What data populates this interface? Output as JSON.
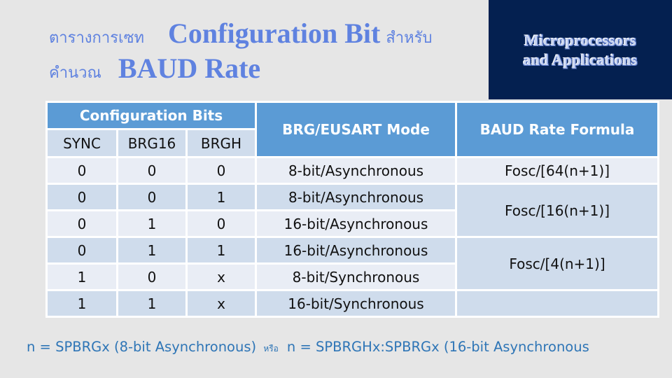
{
  "title": {
    "line1_thai_prefix": "ตารางการเซท",
    "line1_english": "Configuration Bit",
    "line1_thai_suffix": "สำหรับ",
    "line2_thai_prefix": "คำนวณ",
    "line2_english": "BAUD Rate"
  },
  "brand": {
    "line1": "Microprocessors",
    "line2": "and Applications",
    "background": "#042050"
  },
  "table": {
    "group_header": "Configuration Bits",
    "bit_headers": [
      "SYNC",
      "BRG16",
      "BRGH"
    ],
    "mode_header": "BRG/EUSART Mode",
    "formula_header": "BAUD Rate Formula",
    "rows": [
      {
        "sync": "0",
        "brg16": "0",
        "brgh": "0",
        "mode": "8-bit/Asynchronous"
      },
      {
        "sync": "0",
        "brg16": "0",
        "brgh": "1",
        "mode": "8-bit/Asynchronous"
      },
      {
        "sync": "0",
        "brg16": "1",
        "brgh": "0",
        "mode": "16-bit/Asynchronous"
      },
      {
        "sync": "0",
        "brg16": "1",
        "brgh": "1",
        "mode": "16-bit/Asynchronous"
      },
      {
        "sync": "1",
        "brg16": "0",
        "brgh": "x",
        "mode": "8-bit/Synchronous"
      },
      {
        "sync": "1",
        "brg16": "1",
        "brgh": "x",
        "mode": "16-bit/Synchronous"
      }
    ],
    "formulas": [
      "Fosc/[64(n+1)]",
      "Fosc/[16(n+1)]",
      "Fosc/[4(n+1)]",
      ""
    ],
    "colors": {
      "header": "#5b9bd5",
      "row_light": "#e9edf5",
      "row_dark": "#cfdcec"
    }
  },
  "footnote": {
    "part1": "n = SPBRGx (8-bit Asynchronous)",
    "or_thai": "หรือ",
    "part2": "n = SPBRGHx:SPBRGx (16-bit Asynchronous"
  }
}
